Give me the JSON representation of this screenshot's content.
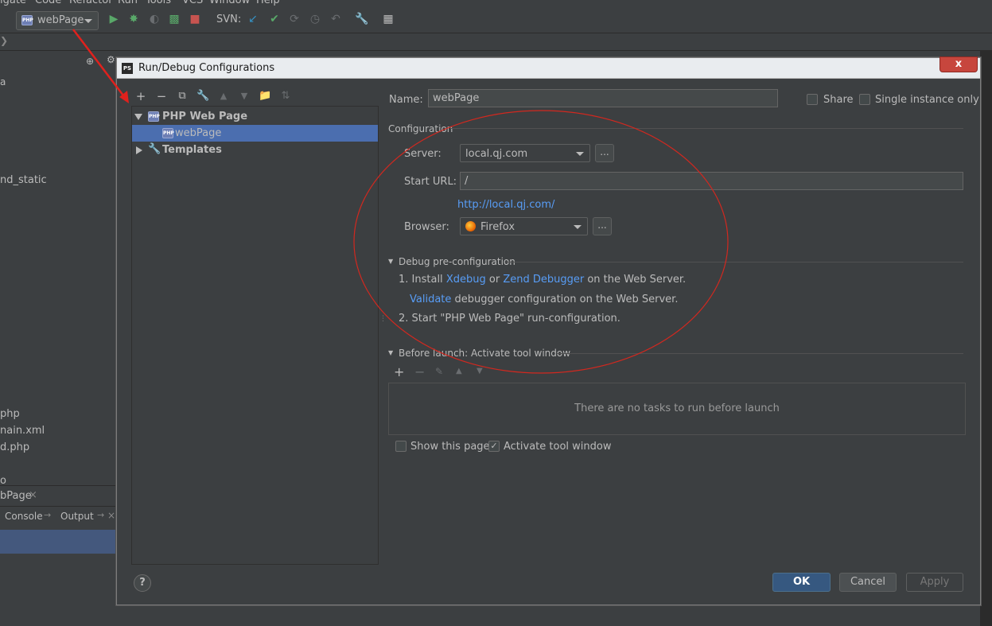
{
  "menu": [
    "igate",
    "Code",
    "Refactor",
    "Run",
    "Tools",
    "VCS",
    "Window",
    "Help"
  ],
  "toolbar": {
    "run_config_label": "webPage",
    "svn_label": "SVN:"
  },
  "left_panel": {
    "files": [
      "nd_static",
      "php",
      "nain.xml",
      "d.php",
      "o"
    ],
    "partial_a": "a",
    "run_tab": "bPage",
    "console_tab": "Console",
    "output_tab": "Output"
  },
  "dialog": {
    "title": "Run/Debug Configurations",
    "close": "x",
    "tree": {
      "group": "PHP Web Page",
      "item": "webPage",
      "templates": "Templates"
    },
    "name_label": "Name:",
    "name_value": "webPage",
    "share_label": "Share",
    "single_instance_label": "Single instance only",
    "configuration_header": "Configuration",
    "server_label": "Server:",
    "server_value": "local.qj.com",
    "start_url_label": "Start URL:",
    "start_url_value": "/",
    "url_link": "http://local.qj.com/",
    "browser_label": "Browser:",
    "browser_value": "Firefox",
    "ellipsis": "...",
    "debug_header": "Debug pre-configuration",
    "step1_prefix": "1. Install",
    "xdebug": "Xdebug",
    "or": "or",
    "zend": "Zend Debugger",
    "step1_suffix": "on the Web Server.",
    "validate": "Validate",
    "validate_suffix": "debugger configuration on the Web Server.",
    "step2": "2. Start \"PHP Web Page\" run-configuration.",
    "before_launch_header": "Before launch: Activate tool window",
    "no_tasks": "There are no tasks to run before launch",
    "show_page_label": "Show this page",
    "activate_label": "Activate tool window",
    "ok": "OK",
    "cancel": "Cancel",
    "apply": "Apply",
    "help": "?"
  },
  "colors": {
    "annotation": "#e0211d",
    "selection": "#4b6eaf",
    "link": "#589df6"
  }
}
